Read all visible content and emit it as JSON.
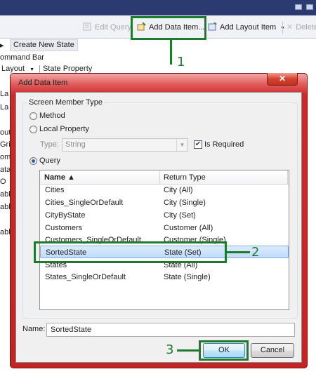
{
  "toolbar": {
    "edit_query": "Edit Query",
    "add_data_item": "Add Data Item...",
    "add_layout_item": "Add Layout Item",
    "delete": "Delete"
  },
  "background": {
    "create_new_state": "Create New State",
    "command_bar": "ommand Bar",
    "layout": "Layout",
    "state_property": "State Property",
    "left_fragments": [
      "La",
      "La",
      "out",
      "Gri",
      "omi",
      "ata",
      "O",
      "abl",
      "abl",
      "abl"
    ]
  },
  "dialog": {
    "title": "Add Data Item",
    "close_glyph": "✕",
    "group_label": "Screen Member Type",
    "options": {
      "method": "Method",
      "local_property": "Local Property",
      "query": "Query",
      "selected": "query"
    },
    "type_label": "Type:",
    "type_value": "String",
    "is_required_label": "Is Required",
    "is_required_checked": true,
    "columns": {
      "name": "Name ▲",
      "return_type": "Return Type"
    },
    "rows": [
      {
        "name": "Cities",
        "return_type": "City (All)"
      },
      {
        "name": "Cities_SingleOrDefault",
        "return_type": "City (Single)"
      },
      {
        "name": "CityByState",
        "return_type": "City (Set)"
      },
      {
        "name": "Customers",
        "return_type": "Customer (All)"
      },
      {
        "name": "Customers_SingleOrDefault",
        "return_type": "Customer (Single)"
      },
      {
        "name": "SortedState",
        "return_type": "State (Set)"
      },
      {
        "name": "States",
        "return_type": "State (All)"
      },
      {
        "name": "States_SingleOrDefault",
        "return_type": "State (Single)"
      }
    ],
    "selected_row": 5,
    "name_label": "Name:",
    "name_value": "SortedState",
    "ok_label": "OK",
    "cancel_label": "Cancel"
  },
  "callouts": [
    "1",
    "2",
    "3"
  ],
  "colors": {
    "callout": "#1e7a2c",
    "dialog_frame": "#cc2a2a",
    "selection": "#c1dcfc"
  }
}
